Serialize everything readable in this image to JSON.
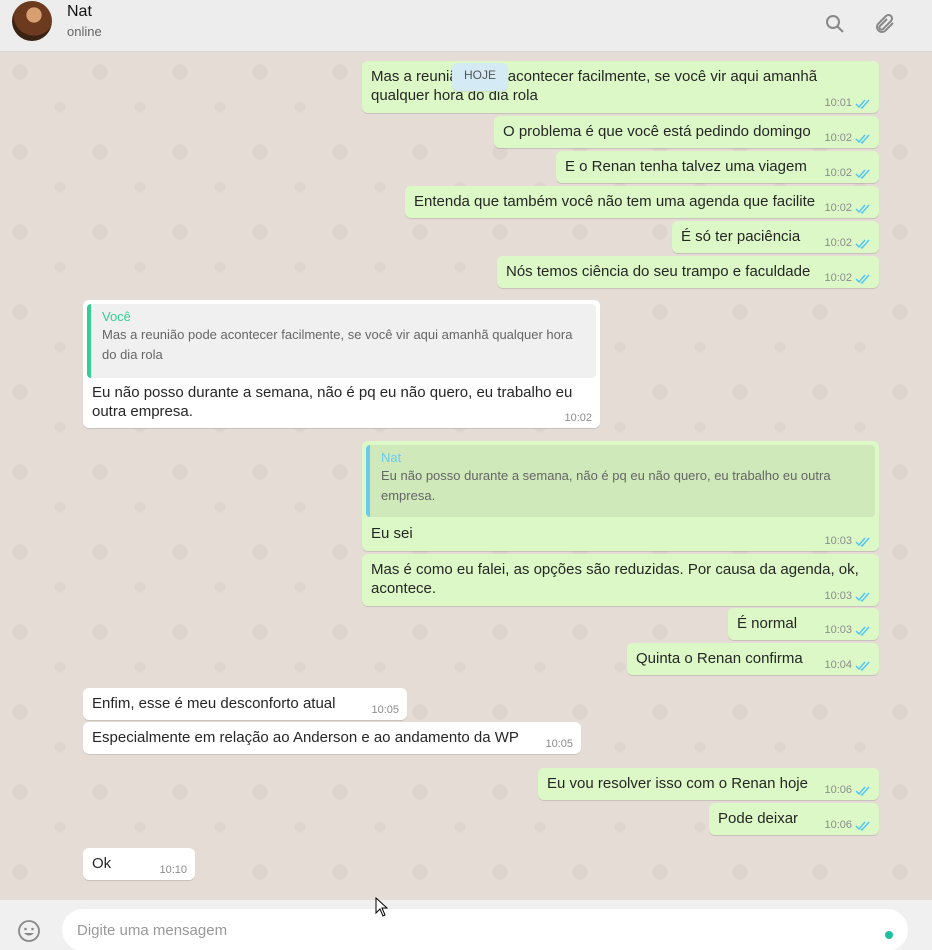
{
  "header": {
    "contact_name": "Nat",
    "status": "online"
  },
  "day_divider": "HOJE",
  "messages": [
    {
      "dir": "out",
      "text": "Mas a reunião pode acontecer facilmente, se você vir aqui amanhã qualquer hora do dia rola",
      "time": "10:01"
    },
    {
      "dir": "out",
      "text": "O problema é que você está pedindo domingo",
      "time": "10:02"
    },
    {
      "dir": "out",
      "text": "E o Renan tenha talvez uma viagem",
      "time": "10:02"
    },
    {
      "dir": "out",
      "text": "Entenda que também você não tem uma agenda que facilite",
      "time": "10:02"
    },
    {
      "dir": "out",
      "text": "É só ter paciência",
      "time": "10:02"
    },
    {
      "dir": "out",
      "text": "Nós temos ciência do seu trampo e faculdade",
      "time": "10:02"
    },
    {
      "dir": "in",
      "quote_name": "Você",
      "quote_text": "Mas a reunião pode acontecer facilmente, se você vir aqui amanhã qualquer hora do dia rola",
      "text": "Eu não posso durante a semana, não é pq eu não quero, eu trabalho eu outra empresa.",
      "time": "10:02"
    },
    {
      "dir": "out",
      "quote_name": "Nat",
      "quote_text": "Eu não posso durante a semana, não é pq eu não quero, eu trabalho eu outra empresa.",
      "text": "Eu sei",
      "time": "10:03"
    },
    {
      "dir": "out",
      "text": "Mas é como eu falei, as opções são reduzidas. Por causa da agenda, ok, acontece.",
      "time": "10:03"
    },
    {
      "dir": "out",
      "text": "É normal",
      "time": "10:03"
    },
    {
      "dir": "out",
      "text": "Quinta o Renan confirma",
      "time": "10:04"
    },
    {
      "dir": "in",
      "text": "Enfim, esse é meu desconforto atual",
      "time": "10:05"
    },
    {
      "dir": "in",
      "text": "Especialmente em relação ao Anderson e ao andamento da WP",
      "time": "10:05"
    },
    {
      "dir": "out",
      "text": "Eu vou resolver isso com o Renan hoje",
      "time": "10:06"
    },
    {
      "dir": "out",
      "text": "Pode deixar",
      "time": "10:06"
    },
    {
      "dir": "in",
      "text": "Ok",
      "time": "10:10"
    }
  ],
  "composer": {
    "placeholder": "Digite uma mensagem"
  },
  "colors": {
    "outgoing_bubble": "#dcf8c6",
    "incoming_bubble": "#ffffff",
    "read_ticks": "#4fc3f7",
    "chat_background": "#e5ddd5"
  },
  "icons": [
    "search-icon",
    "paperclip-icon",
    "emoji-icon",
    "double-check-icon"
  ]
}
